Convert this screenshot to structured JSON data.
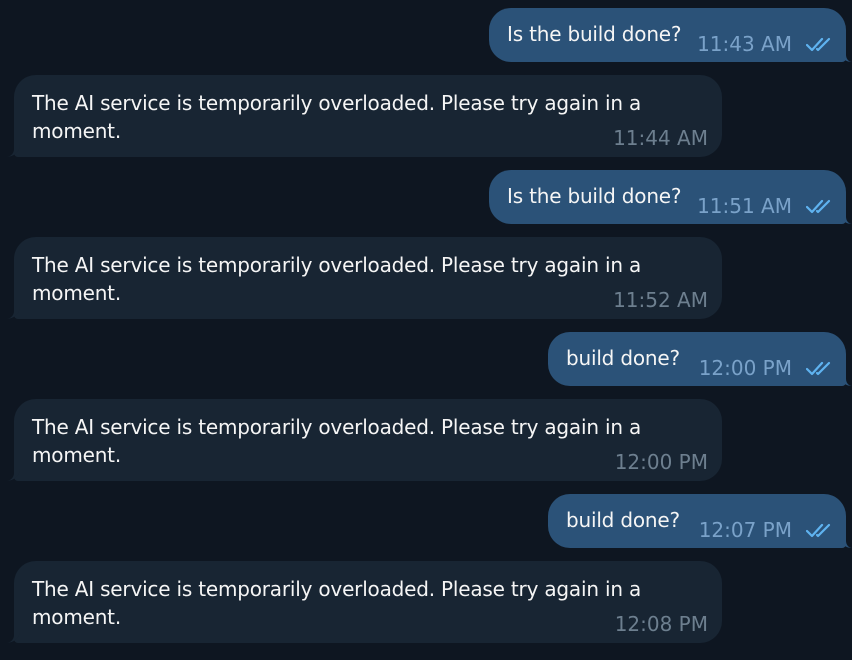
{
  "messages": [
    {
      "direction": "out",
      "text": "Is the build done?",
      "time": "11:43 AM",
      "status": "read"
    },
    {
      "direction": "in",
      "text": "The AI service is temporarily overloaded. Please try again in a moment.",
      "time": "11:44 AM"
    },
    {
      "direction": "out",
      "text": "Is the build done?",
      "time": "11:51 AM",
      "status": "read"
    },
    {
      "direction": "in",
      "text": "The AI service is temporarily overloaded. Please try again in a moment.",
      "time": "11:52 AM"
    },
    {
      "direction": "out",
      "text": "build done?",
      "time": "12:00 PM",
      "status": "read"
    },
    {
      "direction": "in",
      "text": "The AI service is temporarily overloaded. Please try again in a moment.",
      "time": "12:00 PM"
    },
    {
      "direction": "out",
      "text": "build done?",
      "time": "12:07 PM",
      "status": "read"
    },
    {
      "direction": "in",
      "text": "The AI service is temporarily overloaded. Please try again in a moment.",
      "time": "12:08 PM"
    }
  ],
  "colors": {
    "background": "#0e1621",
    "outgoing_bubble": "#2b5278",
    "incoming_bubble": "#182533",
    "read_check": "#5fb3f0"
  },
  "icons": {
    "read_status": "double-check-icon"
  }
}
